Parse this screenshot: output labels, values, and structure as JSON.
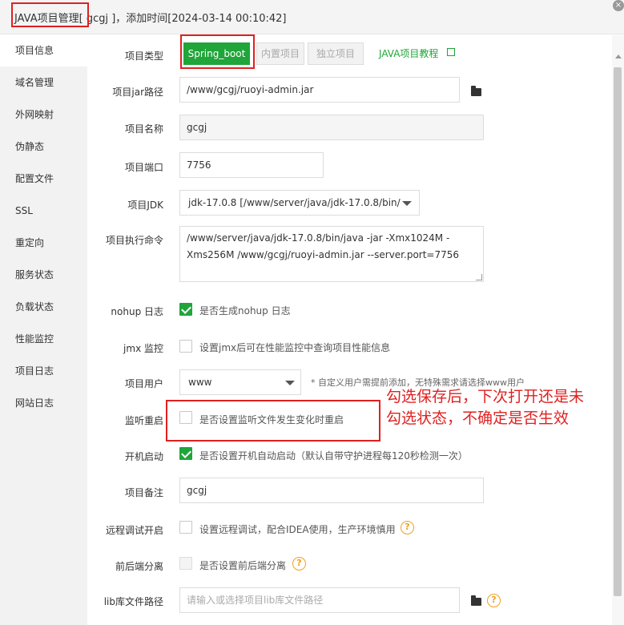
{
  "window": {
    "title_prefix": "JAVA项目管理",
    "title_rest": "[ gcgj ]，添加时间[2024-03-14 00:10:42]",
    "close_glyph": "×"
  },
  "sidebar": {
    "items": [
      {
        "label": "项目信息",
        "active": true
      },
      {
        "label": "域名管理"
      },
      {
        "label": "外网映射"
      },
      {
        "label": "伪静态"
      },
      {
        "label": "配置文件"
      },
      {
        "label": "SSL"
      },
      {
        "label": "重定向"
      },
      {
        "label": "服务状态"
      },
      {
        "label": "负载状态"
      },
      {
        "label": "性能监控"
      },
      {
        "label": "项目日志"
      },
      {
        "label": "网站日志"
      }
    ]
  },
  "form": {
    "project_type": {
      "label": "项目类型",
      "options": [
        "Spring_boot",
        "内置项目",
        "独立项目"
      ],
      "selected": "Spring_boot",
      "tutorial_link": "JAVA项目教程"
    },
    "jar_path": {
      "label": "项目jar路径",
      "value": "/www/gcgj/ruoyi-admin.jar"
    },
    "name": {
      "label": "项目名称",
      "value": "gcgj"
    },
    "port": {
      "label": "项目端口",
      "value": "7756"
    },
    "jdk": {
      "label": "项目JDK",
      "value": "jdk-17.0.8 [/www/server/java/jdk-17.0.8/bin/"
    },
    "command": {
      "label": "项目执行命令",
      "line1": "/www/server/java/jdk-17.0.8/bin/java  -jar -Xmx1024M -",
      "line2": "Xms256M  /www/gcgj/ruoyi-admin.jar --server.port=7756"
    },
    "nohup": {
      "label": "nohup 日志",
      "text": "是否生成nohup 日志",
      "checked": true
    },
    "jmx": {
      "label": "jmx 监控",
      "text": "设置jmx后可在性能监控中查询项目性能信息",
      "checked": false
    },
    "user": {
      "label": "项目用户",
      "value": "www",
      "hint": "* 自定义用户需提前添加，无特殊需求请选择www用户"
    },
    "watch_restart": {
      "label": "监听重启",
      "text": "是否设置监听文件发生变化时重启",
      "checked": false
    },
    "autostart": {
      "label": "开机启动",
      "text": "是否设置开机自动启动（默认自带守护进程每120秒检测一次）",
      "checked": true
    },
    "remark": {
      "label": "项目备注",
      "value": "gcgj"
    },
    "remote_debug": {
      "label": "远程调试开启",
      "text": "设置远程调试，配合IDEA使用，生产环境慎用",
      "checked": false
    },
    "separation": {
      "label": "前后端分离",
      "text": "是否设置前后端分离",
      "checked": false
    },
    "lib_path": {
      "label": "lib库文件路径",
      "placeholder": "请输入或选择项目lib库文件路径"
    }
  },
  "annotation": {
    "text": "勾选保存后，下次打开还是未勾选状态，不确定是否生效"
  },
  "colors": {
    "accent": "#20a53a",
    "annotation_red": "#e02020",
    "help_orange": "#f0a020",
    "sidebar_bg": "#f2f2f2"
  },
  "icons": {
    "folder": "folder-icon",
    "external": "external-link-icon",
    "help": "help-icon",
    "close": "close-icon"
  }
}
